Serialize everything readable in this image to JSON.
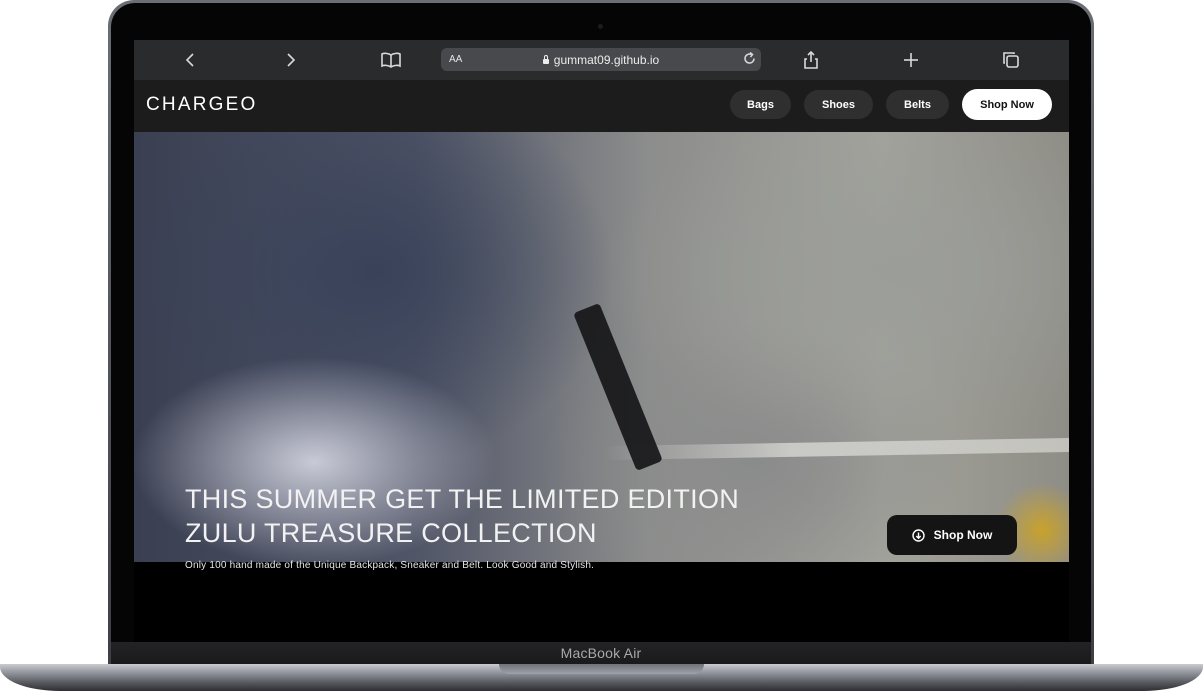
{
  "device": {
    "label": "MacBook Air"
  },
  "browser": {
    "reader_label": "AA",
    "url": "gummat09.github.io",
    "icons": [
      "back-icon",
      "forward-icon",
      "bookmarks-icon",
      "reload-icon",
      "share-icon",
      "new-tab-icon",
      "tabs-icon"
    ]
  },
  "site": {
    "logo": "CHARGEO",
    "nav": [
      {
        "label": "Bags"
      },
      {
        "label": "Shoes"
      },
      {
        "label": "Belts"
      }
    ],
    "nav_cta": "Shop Now"
  },
  "hero": {
    "title_line1": "THIS SUMMER GET THE LIMITED EDITION",
    "title_line2": "ZULU TREASURE COLLECTION",
    "subtitle": "Only 100 hand made of the Unique Backpack, Sneaker and Belt. Look Good and Stylish.",
    "cta_label": "Shop Now",
    "cta_icon": "arrow-down-circle-icon"
  },
  "colors": {
    "nav_bg": "#1c1c1c",
    "nav_button_bg": "#2f2f2f",
    "cta_bg": "#ffffff",
    "hero_cta_bg": "#141414",
    "safari_bar_bg": "#2a2b2d"
  }
}
